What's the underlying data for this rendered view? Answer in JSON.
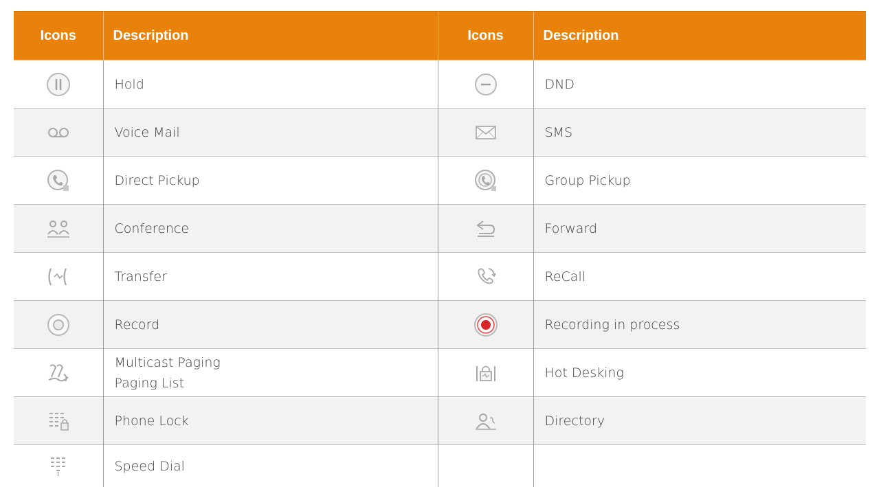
{
  "header": {
    "icons_label_1": "Icons",
    "description_label_1": "Description",
    "icons_label_2": "Icons",
    "description_label_2": "Description"
  },
  "colors": {
    "header_bg": "#e8820c",
    "header_text": "#ffffff",
    "alt_row_bg": "#f2f2f2",
    "icon_gray": "#b5b5b5",
    "record_red": "#d8262a"
  },
  "rows": [
    {
      "left": {
        "icon": "hold-icon",
        "label": "Hold"
      },
      "right": {
        "icon": "dnd-icon",
        "label": "DND"
      }
    },
    {
      "left": {
        "icon": "voicemail-icon",
        "label": "Voice Mail"
      },
      "right": {
        "icon": "envelope-icon",
        "label": "SMS"
      }
    },
    {
      "left": {
        "icon": "direct-pickup-icon",
        "label": "Direct Pickup"
      },
      "right": {
        "icon": "group-pickup-icon",
        "label": "Group Pickup"
      }
    },
    {
      "left": {
        "icon": "conference-icon",
        "label": "Conference"
      },
      "right": {
        "icon": "forward-icon",
        "label": "Forward"
      }
    },
    {
      "left": {
        "icon": "transfer-icon",
        "label": "Transfer"
      },
      "right": {
        "icon": "recall-icon",
        "label": "ReCall"
      }
    },
    {
      "left": {
        "icon": "record-icon",
        "label": "Record"
      },
      "right": {
        "icon": "recording-in-process-icon",
        "label": "Recording in process"
      }
    },
    {
      "left": {
        "icon": "multicast-paging-icon",
        "label_line1": "Multicast Paging",
        "label_line2": "Paging List"
      },
      "right": {
        "icon": "hot-desking-icon",
        "label": "Hot Desking"
      }
    },
    {
      "left": {
        "icon": "phone-lock-icon",
        "label": "Phone Lock"
      },
      "right": {
        "icon": "directory-icon",
        "label": "Directory"
      }
    },
    {
      "left": {
        "icon": "speed-dial-icon",
        "label": "Speed Dial"
      },
      "right": {
        "icon": "",
        "label": ""
      }
    }
  ]
}
